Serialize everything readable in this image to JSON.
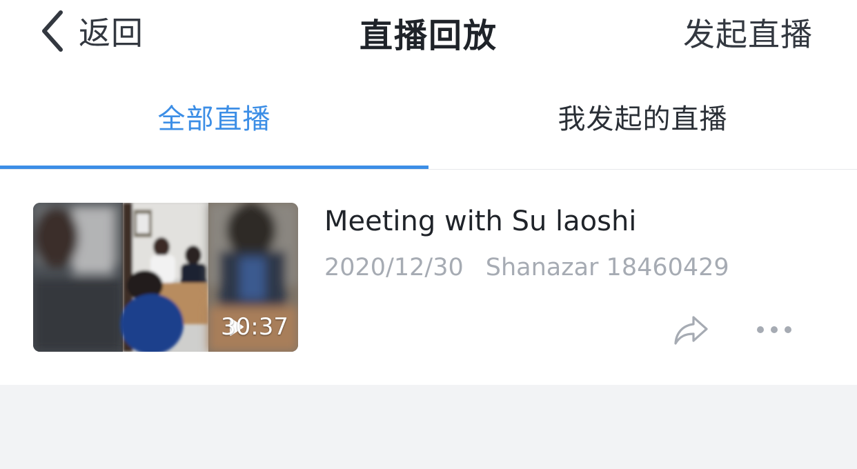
{
  "header": {
    "back_label": "返回",
    "title": "直播回放",
    "start_live_label": "发起直播"
  },
  "tabs": [
    {
      "label": "全部直播",
      "active": true
    },
    {
      "label": "我发起的直播",
      "active": false
    }
  ],
  "recordings": [
    {
      "title": "Meeting with Su laoshi",
      "date": "2020/12/30",
      "owner": "Shanazar 18460429",
      "duration": "30:37"
    }
  ],
  "icons": {
    "back": "chevron-left-icon",
    "play": "play-icon",
    "share": "share-icon",
    "more": "more-dots-icon"
  },
  "colors": {
    "accent": "#3c8ee6",
    "text_primary": "#1f2329",
    "text_secondary": "#a6abb3",
    "page_background": "#f2f3f5"
  }
}
